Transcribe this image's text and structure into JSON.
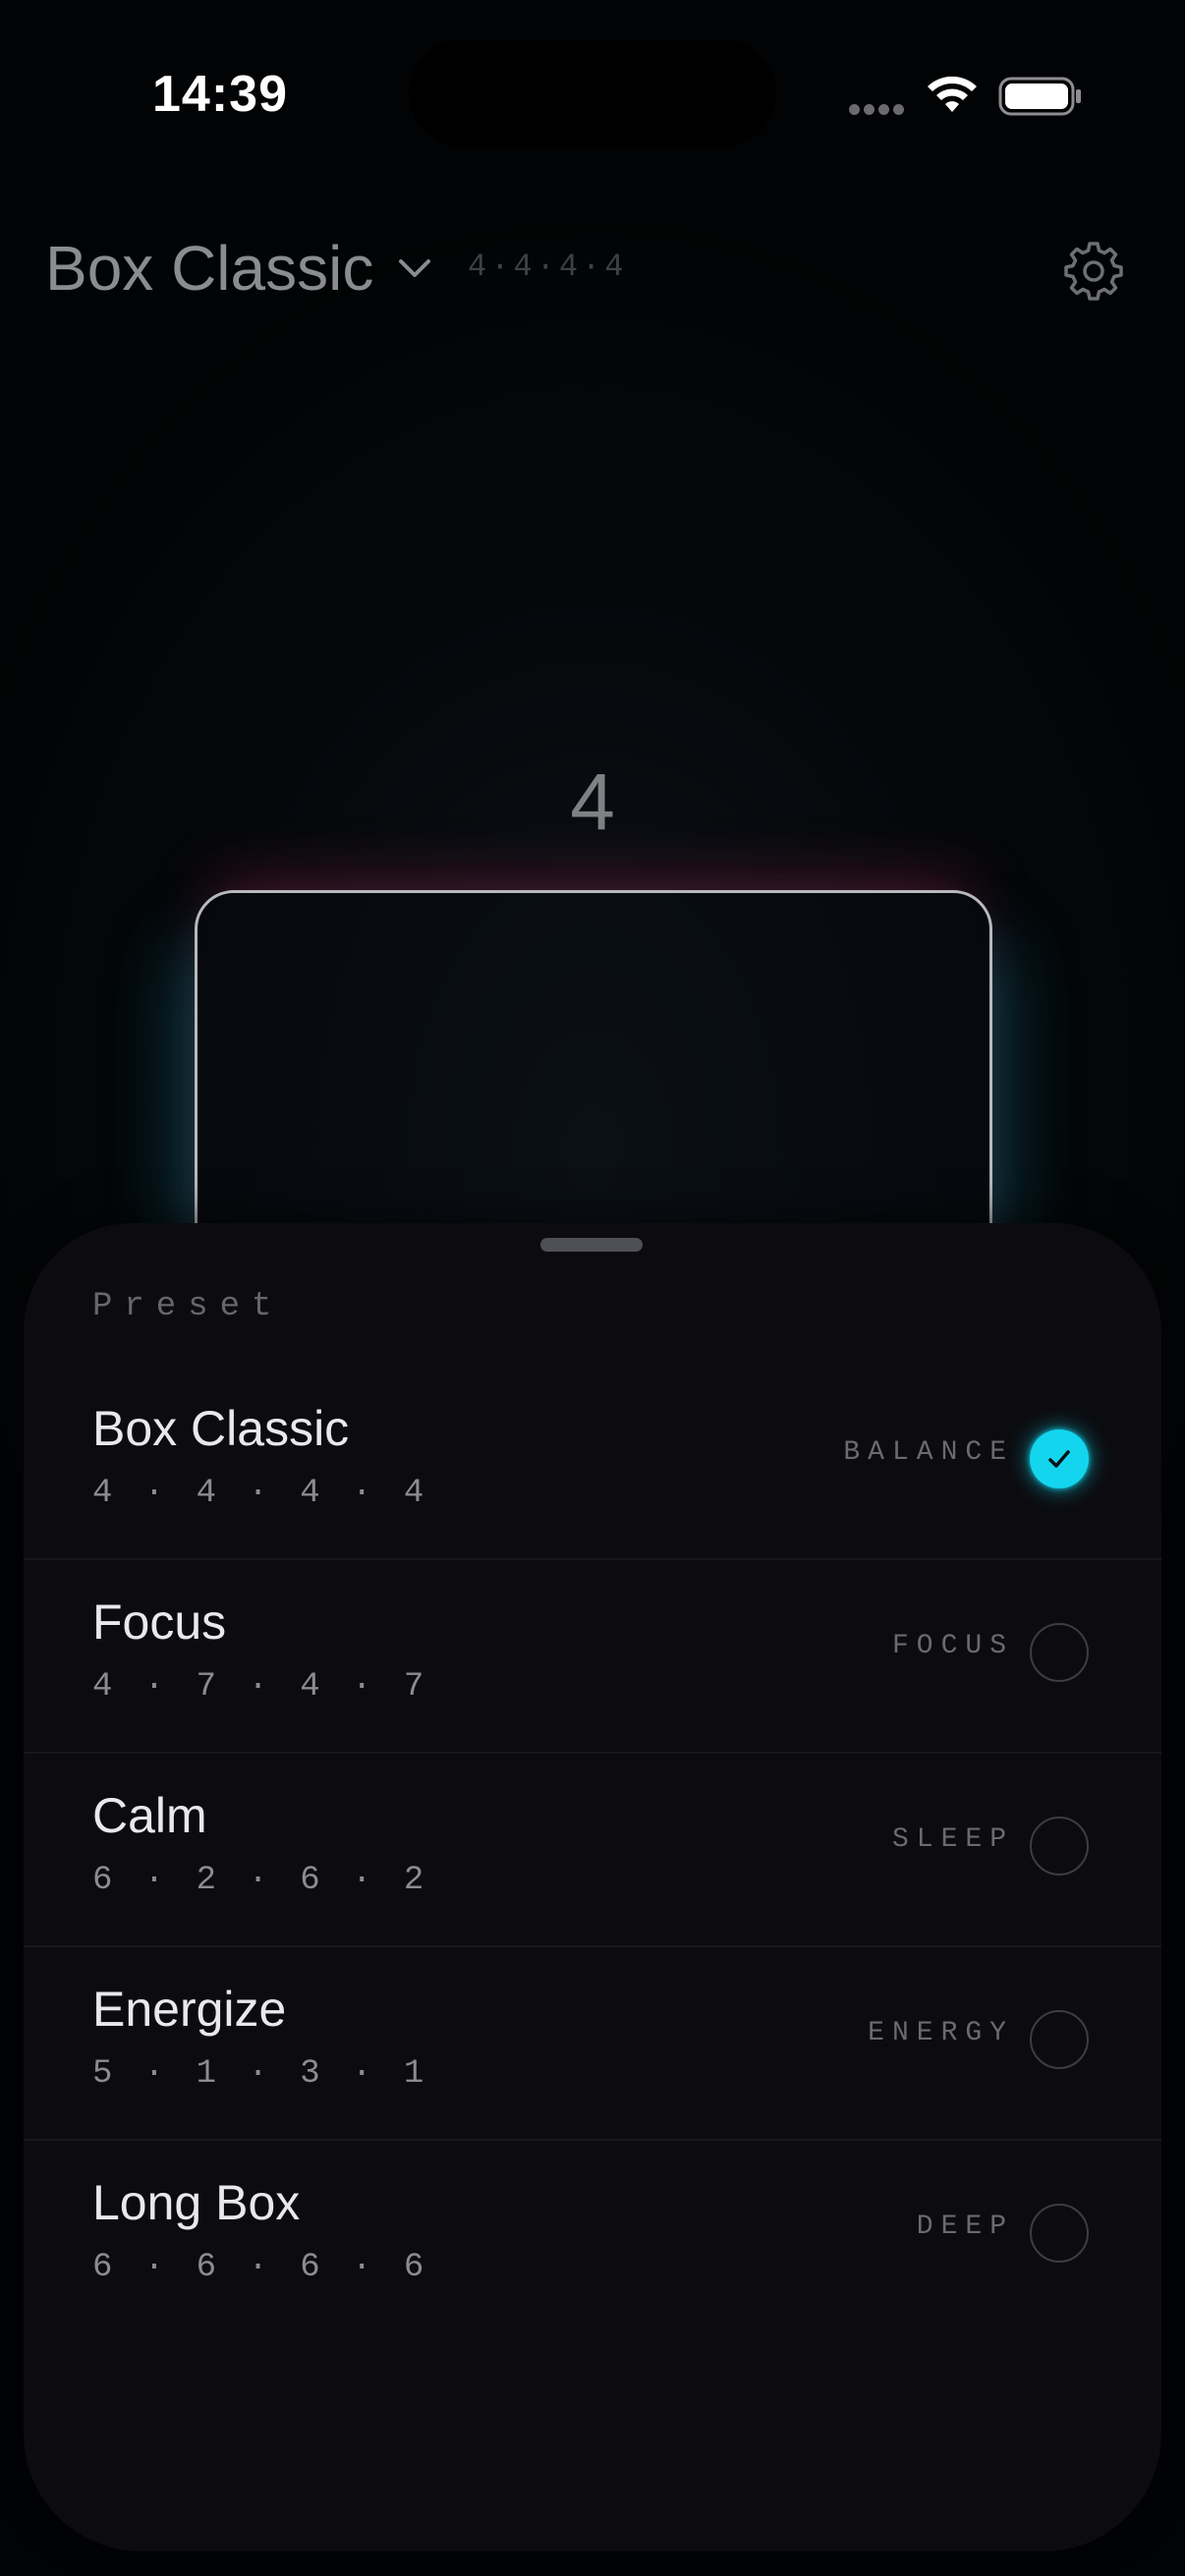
{
  "status_bar": {
    "time": "14:39"
  },
  "header": {
    "title": "Box Classic",
    "pattern": "4·4·4·4",
    "chevron_icon": "chevron-down-icon",
    "settings_icon": "gear-icon"
  },
  "breath": {
    "count": "4"
  },
  "sheet": {
    "label": "Preset",
    "presets": [
      {
        "name": "Box Classic",
        "pattern": "4 · 4 · 4 · 4",
        "tag": "BALANCE",
        "selected": true
      },
      {
        "name": "Focus",
        "pattern": "4 · 7 · 4 · 7",
        "tag": "FOCUS",
        "selected": false
      },
      {
        "name": "Calm",
        "pattern": "6 · 2 · 6 · 2",
        "tag": "SLEEP",
        "selected": false
      },
      {
        "name": "Energize",
        "pattern": "5 · 1 · 3 · 1",
        "tag": "ENERGY",
        "selected": false
      },
      {
        "name": "Long Box",
        "pattern": "6 · 6 · 6 · 6",
        "tag": "DEEP",
        "selected": false
      }
    ]
  },
  "colors": {
    "accent": "#13d6ee",
    "sheet_bg": "#0c0c10",
    "box_stroke": "#b8b9bd"
  }
}
